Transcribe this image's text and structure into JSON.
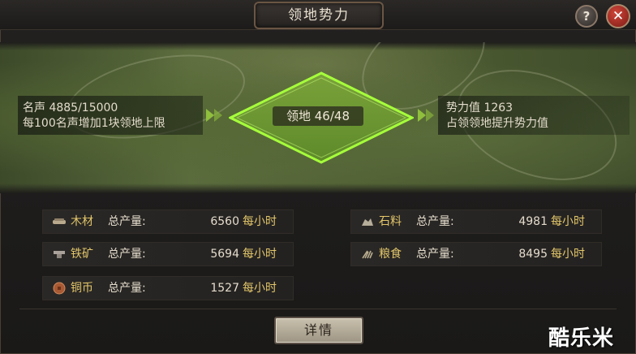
{
  "window": {
    "title": "领地势力",
    "help_glyph": "?",
    "close_glyph": "✕"
  },
  "map": {
    "fame_line": "名声 4885/15000",
    "fame_hint": "每100名声增加1块领地上限",
    "territory_label": "领地 46/48",
    "power_line": "势力值 1263",
    "power_hint": "占领领地提升势力值"
  },
  "resources": {
    "label": "总产量:",
    "unit": "每小时",
    "items": [
      {
        "name": "木材",
        "value": "6560",
        "icon": "wood-icon"
      },
      {
        "name": "石料",
        "value": "4981",
        "icon": "stone-icon"
      },
      {
        "name": "铁矿",
        "value": "5694",
        "icon": "iron-icon"
      },
      {
        "name": "粮食",
        "value": "8495",
        "icon": "grain-icon"
      },
      {
        "name": "铜币",
        "value": "1527",
        "icon": "copper-coin-icon"
      }
    ]
  },
  "details_button": "详情",
  "watermark": "酷乐米",
  "colors": {
    "accent_green": "#8fd23a",
    "resource_name": "#e3c76a",
    "close_red": "#c0392b"
  }
}
